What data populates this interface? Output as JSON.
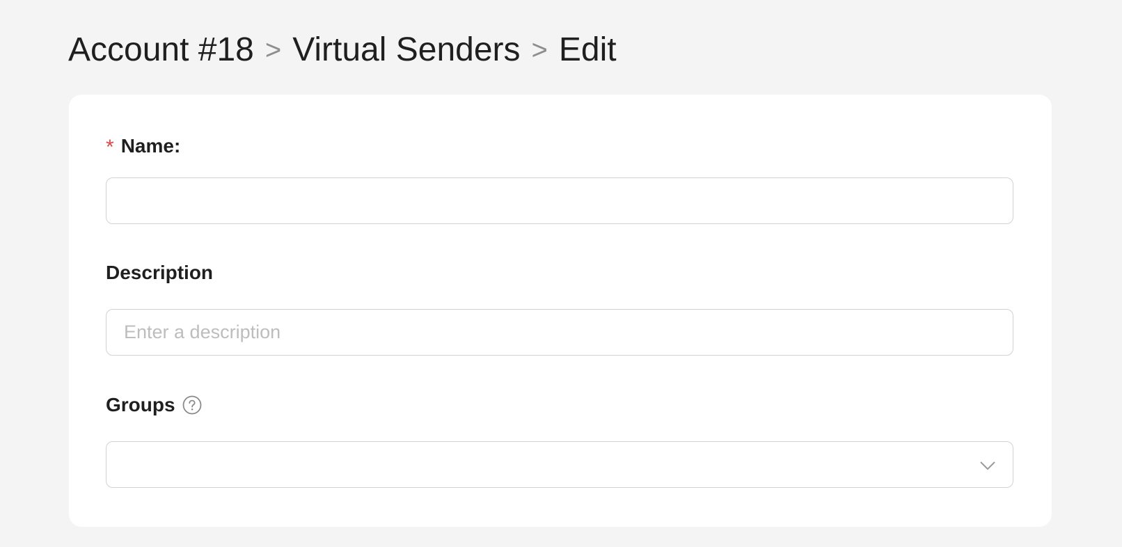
{
  "breadcrumb": {
    "items": [
      "Account #18",
      "Virtual Senders",
      "Edit"
    ],
    "separator": ">"
  },
  "form": {
    "name": {
      "required_mark": "*",
      "label": "Name:",
      "value": "",
      "placeholder": ""
    },
    "description": {
      "label": "Description",
      "value": "",
      "placeholder": "Enter a description"
    },
    "groups": {
      "label": "Groups",
      "help_icon": "question-circle-icon",
      "selected": "",
      "dropdown_icon": "chevron-down-icon"
    }
  },
  "colors": {
    "background": "#f4f4f4",
    "card": "#ffffff",
    "required": "#e0484a",
    "border": "#d2d2d2",
    "separator": "#8e8e8e"
  }
}
